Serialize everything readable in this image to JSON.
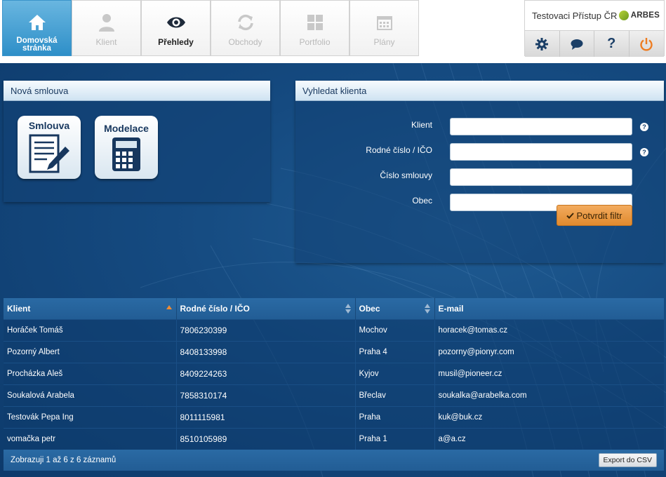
{
  "nav": {
    "items": [
      {
        "label": "Domovská stránka",
        "icon": "home-icon"
      },
      {
        "label": "Klient",
        "icon": "person-icon"
      },
      {
        "label": "Přehledy",
        "icon": "eye-icon"
      },
      {
        "label": "Obchody",
        "icon": "refresh-icon"
      },
      {
        "label": "Portfolio",
        "icon": "grid-icon"
      },
      {
        "label": "Plány",
        "icon": "calendar-icon"
      }
    ]
  },
  "user": {
    "name": "Testovaci Přístup ČR",
    "logo_text": "ARBES",
    "actions": [
      "gear-icon",
      "chat-icon",
      "help-icon",
      "power-icon"
    ]
  },
  "colors": {
    "accent_blue": "#2e8fc8",
    "filter_orange": "#e08a2e",
    "sort_active": "#f08c32"
  },
  "new_contract": {
    "title": "Nová smlouva",
    "tiles": [
      {
        "label": "Smlouva",
        "icon": "document-pen-icon"
      },
      {
        "label": "Modelace",
        "icon": "calculator-icon"
      }
    ]
  },
  "search": {
    "title": "Vyhledat klienta",
    "fields": [
      {
        "label": "Klient",
        "value": "",
        "help": "?"
      },
      {
        "label": "Rodné číslo / IČO",
        "value": "",
        "help": "?"
      },
      {
        "label": "Číslo smlouvy",
        "value": ""
      },
      {
        "label": "Obec",
        "value": ""
      }
    ],
    "submit_label": "Potvrdit filtr"
  },
  "table": {
    "columns": [
      "Klient",
      "Rodné číslo / IČO",
      "Obec",
      "E-mail"
    ],
    "rows": [
      [
        "Horáček Tomáš",
        "7806230399",
        "Mochov",
        "horacek@tomas.cz"
      ],
      [
        "Pozorný Albert",
        "8408133998",
        "Praha 4",
        "pozorny@pionyr.com"
      ],
      [
        "Procházka Aleš",
        "8409224263",
        "Kyjov",
        "musil@pioneer.cz"
      ],
      [
        "Soukalová Arabela",
        "7858310174",
        "Břeclav",
        "soukalka@arabelka.com"
      ],
      [
        "Testovák Pepa Ing",
        "8011115981",
        "Praha",
        "kuk@buk.cz"
      ],
      [
        "vomačka petr",
        "8510105989",
        "Praha 1",
        "a@a.cz"
      ]
    ],
    "footer_text": "Zobrazuji 1 až 6 z 6 záznamů",
    "export_label": "Export do CSV"
  }
}
